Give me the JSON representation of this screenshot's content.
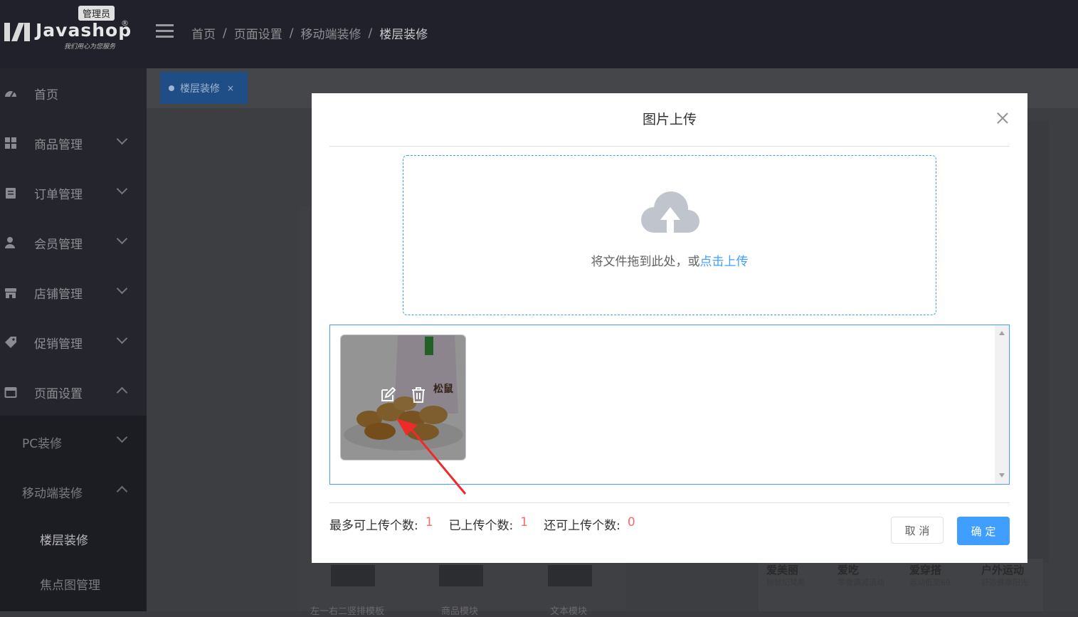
{
  "header": {
    "brand": "Javashop",
    "reg_mark": "®",
    "tagline": "我们用心为您服务",
    "role_badge": "管理员",
    "breadcrumb": [
      "首页",
      "页面设置",
      "移动端装修",
      "楼层装修"
    ],
    "breadcrumb_sep": "/"
  },
  "sidebar": {
    "items": [
      {
        "label": "首页",
        "icon": "dashboard-icon"
      },
      {
        "label": "商品管理",
        "icon": "grid-icon"
      },
      {
        "label": "订单管理",
        "icon": "clipboard-icon"
      },
      {
        "label": "会员管理",
        "icon": "user-icon"
      },
      {
        "label": "店铺管理",
        "icon": "store-icon"
      },
      {
        "label": "促销管理",
        "icon": "tag-icon"
      },
      {
        "label": "页面设置",
        "icon": "window-icon"
      }
    ],
    "sub_items": [
      {
        "label": "PC装修"
      },
      {
        "label": "移动端装修"
      },
      {
        "label": "楼层装修"
      },
      {
        "label": "焦点图管理"
      }
    ]
  },
  "tab": {
    "label": "楼层装修",
    "close": "×"
  },
  "templates": [
    {
      "name": "左一右二竖排模板"
    },
    {
      "name": "商品模块"
    },
    {
      "name": "文本模块"
    }
  ],
  "promos": [
    {
      "title": "爱美丽",
      "sub": "粉丝纪梵希"
    },
    {
      "title": "爱吃",
      "sub": "零食满减活动"
    },
    {
      "title": "爱穿搭",
      "sub": "运动低至69"
    },
    {
      "title": "户外运动",
      "sub": "舒适健康阳光"
    }
  ],
  "dialog": {
    "title": "图片上传",
    "drop_text": "将文件拖到此处，或",
    "drop_link": "点击上传",
    "uploaded_image": {
      "product_label": "松鼠",
      "edit_icon": "edit-icon",
      "delete_icon": "trash-icon"
    },
    "stats": [
      {
        "label": "最多可上传个数:",
        "value": "1"
      },
      {
        "label": "已上传个数:",
        "value": "1"
      },
      {
        "label": "还可上传个数:",
        "value": "0"
      }
    ],
    "cancel_label": "取 消",
    "ok_label": "确 定"
  },
  "colors": {
    "primary": "#409eff",
    "danger": "#f56c6c",
    "annotation_arrow": "#ee2b2b"
  }
}
